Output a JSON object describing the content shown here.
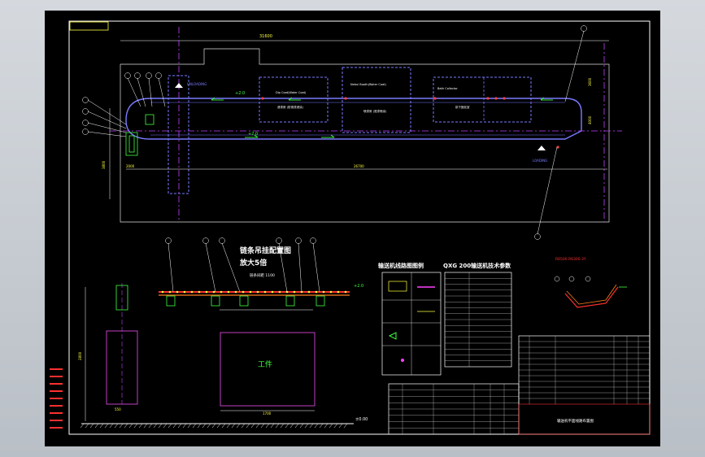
{
  "colors": {
    "background": "#000000",
    "frame": "#ffffff",
    "conveyor": "#7a7aff",
    "centerline": "#c040ff",
    "accent": "#ffff40",
    "green": "#40ff40",
    "red": "#ff3030",
    "equipment": "#c040c0"
  },
  "plan": {
    "dim_top": "31600",
    "dim_left": "3800",
    "dim_bottom_left": "2000",
    "dim_bottom_right": "26700",
    "dim_right_top": "3600",
    "dim_right_bottom": "4000",
    "label_unloading": "UNLOADING",
    "label_loading": "LOADING",
    "speed_top": "+2.0",
    "speed_bottom": "+2.0",
    "box_1_top": "Dip Coat(Water Coat)",
    "box_1_bottom": "浸漆房 (防锈漆浸涂)",
    "box_2_top": "Nebul Booth(Water Coat)",
    "box_2_bottom": "喷漆房 (底漆喷涂)",
    "box_3_top": "Bath Collector",
    "box_3_bottom": "烘干固化室"
  },
  "titles": {
    "layout_diagram": "输送机线路图图例",
    "tech_params": "QXG 200输送机技术参数",
    "enlarge_line1": "链条吊挂配置图",
    "enlarge_line2": "放大5倍",
    "chain_spacing": "链条间距 1100",
    "top_right_detail": "R6500 R6300.3Y"
  },
  "elevation": {
    "dim_height": "2800",
    "dim_width_left": "550",
    "dim_width_mid": "1700",
    "label_workpiece": "工件",
    "ground_level": "±0.00",
    "speed_level": "+2.0"
  },
  "title_block": {
    "drawing_title": "输送机平面线路布置图"
  }
}
